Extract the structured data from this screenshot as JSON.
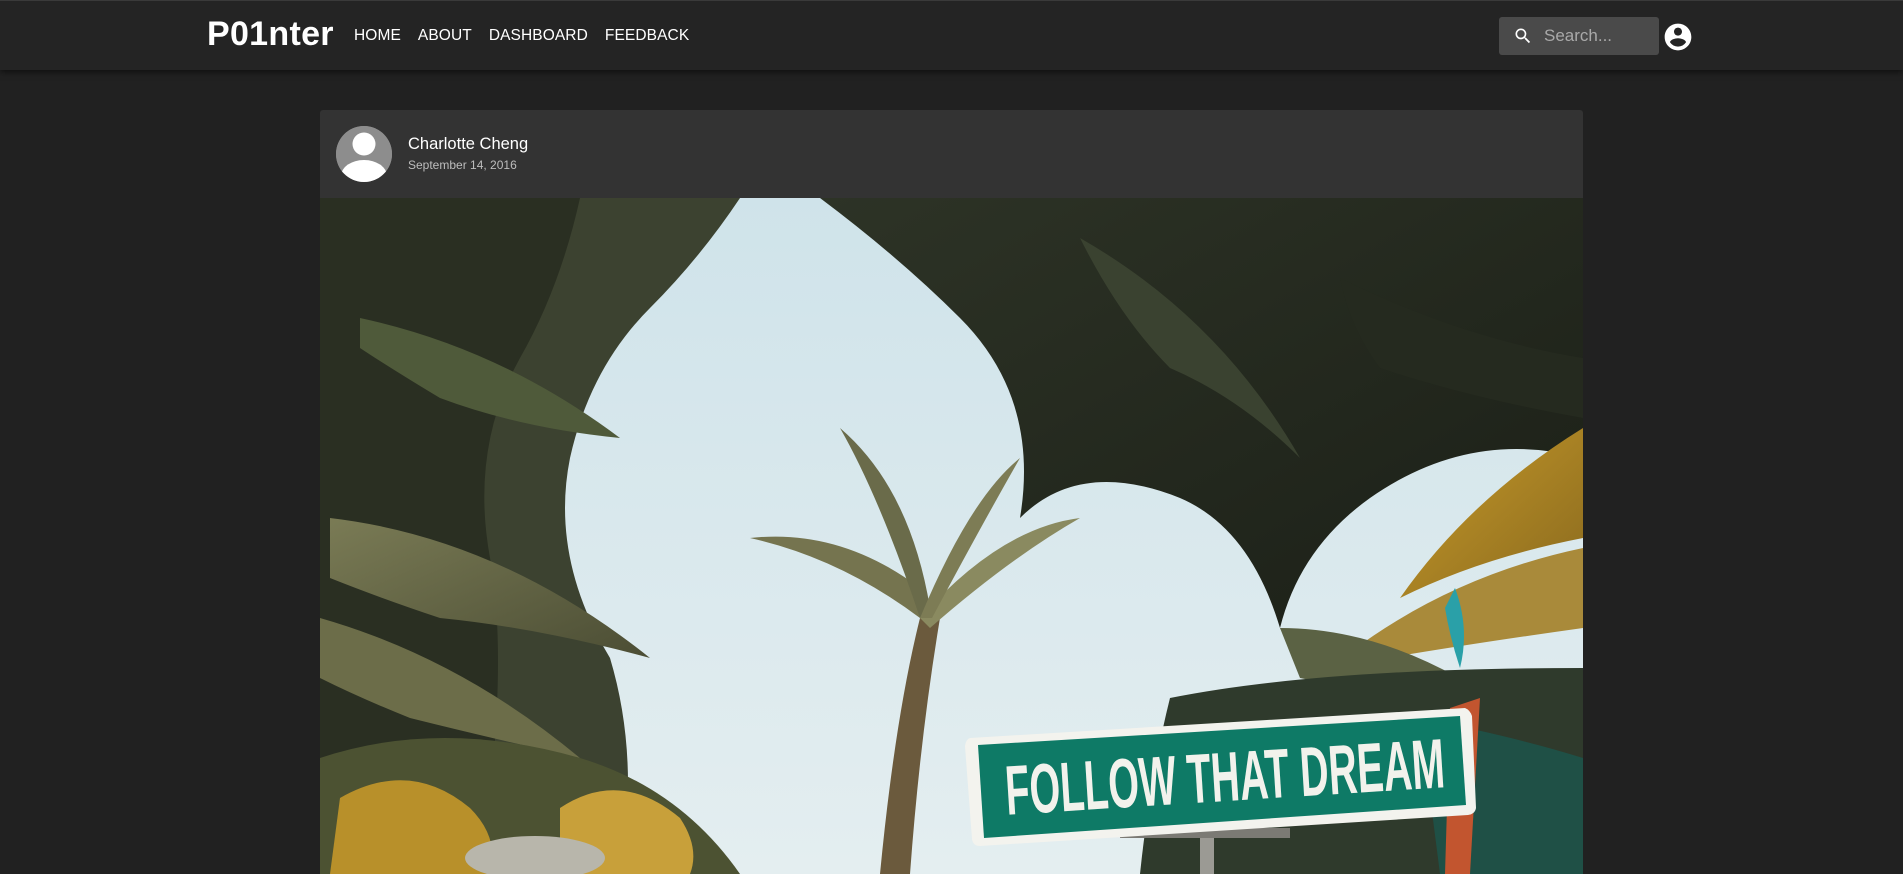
{
  "brand": "P01nter",
  "nav": {
    "items": [
      {
        "label": "HOME"
      },
      {
        "label": "ABOUT"
      },
      {
        "label": "DASHBOARD"
      },
      {
        "label": "FEEDBACK"
      }
    ]
  },
  "search": {
    "placeholder": "Search...",
    "value": "",
    "icon": "search-icon"
  },
  "account": {
    "icon": "account-circle-icon"
  },
  "post": {
    "author": "Charlotte Cheng",
    "date": "September 14, 2016",
    "avatar_icon": "default-user-avatar",
    "image": {
      "sign_text": "FOLLOW THAT DREAM"
    }
  },
  "colors": {
    "page_bg": "#212121",
    "navbar_bg": "#242424",
    "card_bg": "#333333",
    "search_bg": "#4a4a4a",
    "text": "#ffffff",
    "muted_text": "#bdbdbd",
    "sign_green": "#0e7a66"
  }
}
